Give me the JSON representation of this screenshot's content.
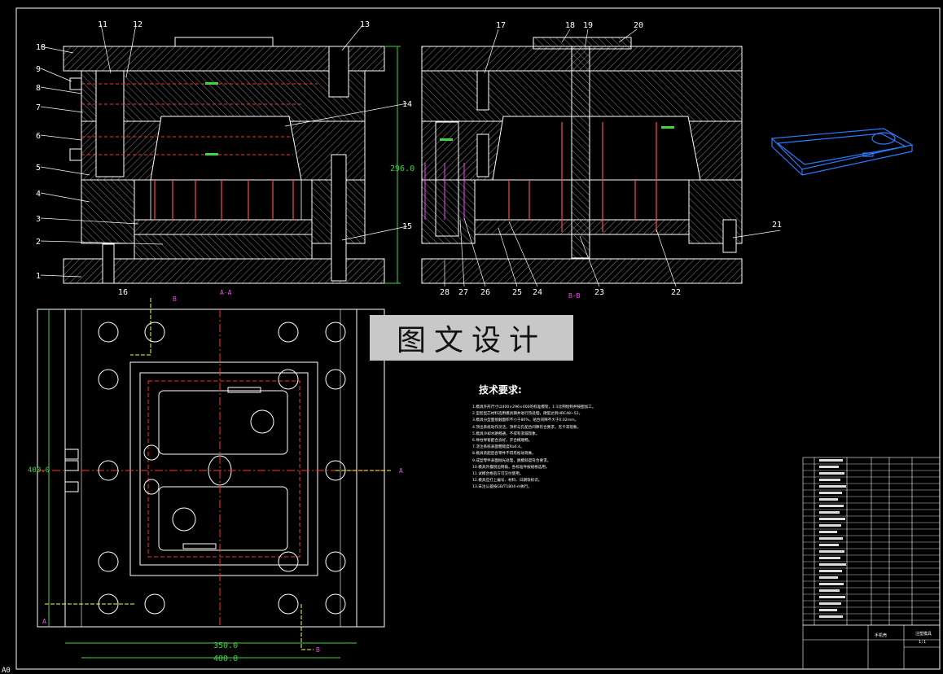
{
  "drawing": {
    "section_aa_label": "A-A",
    "section_bb_label": "B-B",
    "dim_height": "296.0",
    "dim_plan_height": "400.0",
    "dim_plan_inner_width": "350.0",
    "dim_plan_width": "400.0",
    "sheet_mark": "A0",
    "part_numbers_left": [
      "18",
      "9",
      "8",
      "7",
      "6",
      "5",
      "4",
      "3",
      "2",
      "1"
    ],
    "part_numbers_top": [
      "11",
      "12",
      "13"
    ],
    "part_numbers_right": [
      "14",
      "15"
    ],
    "part_number_bottom": "16",
    "part_numbers_b": [
      "17",
      "18",
      "19",
      "20",
      "21"
    ],
    "part_numbers_b_bottom": [
      "28",
      "27",
      "26",
      "25",
      "24",
      "23",
      "22"
    ],
    "section_letters": [
      "A",
      "B"
    ]
  },
  "watermark": "图文设计",
  "notes": {
    "title": "技术要求:",
    "items": [
      "1.模具外形尺寸以400×296×400的标准模架，1:1比例绘制并按图加工。",
      "2.型腔型芯材料选用模具钢并进行热处理，硬度达到HRC48~52。",
      "3.模具分型面接触面积不小于80%，贴合间隙不大于0.02mm。",
      "4.顶出系统动作灵活，顶杆与孔配合间隙符合要求，无卡滞现象。",
      "5.模具冷却水路畅通，不得有渗漏现象。",
      "6.导柱导套配合良好，开合模顺畅。",
      "7.浇注系统表面粗糙度Ra0.4。",
      "8.模具装配后各零件不得有松动现象。",
      "9.成型零件表面抛光处理，脱模斜度符合要求。",
      "10.模具外露锐边倒角，各标准件按规格选用。",
      "11.试模合格后方可交付使用。",
      "12.模具应打上编号、材料、日期等标识。",
      "13.未注公差按GB/T1804-m执行。"
    ]
  },
  "title_block": {
    "name": "手机壳",
    "code": "注塑模具",
    "scale": "1:1"
  }
}
